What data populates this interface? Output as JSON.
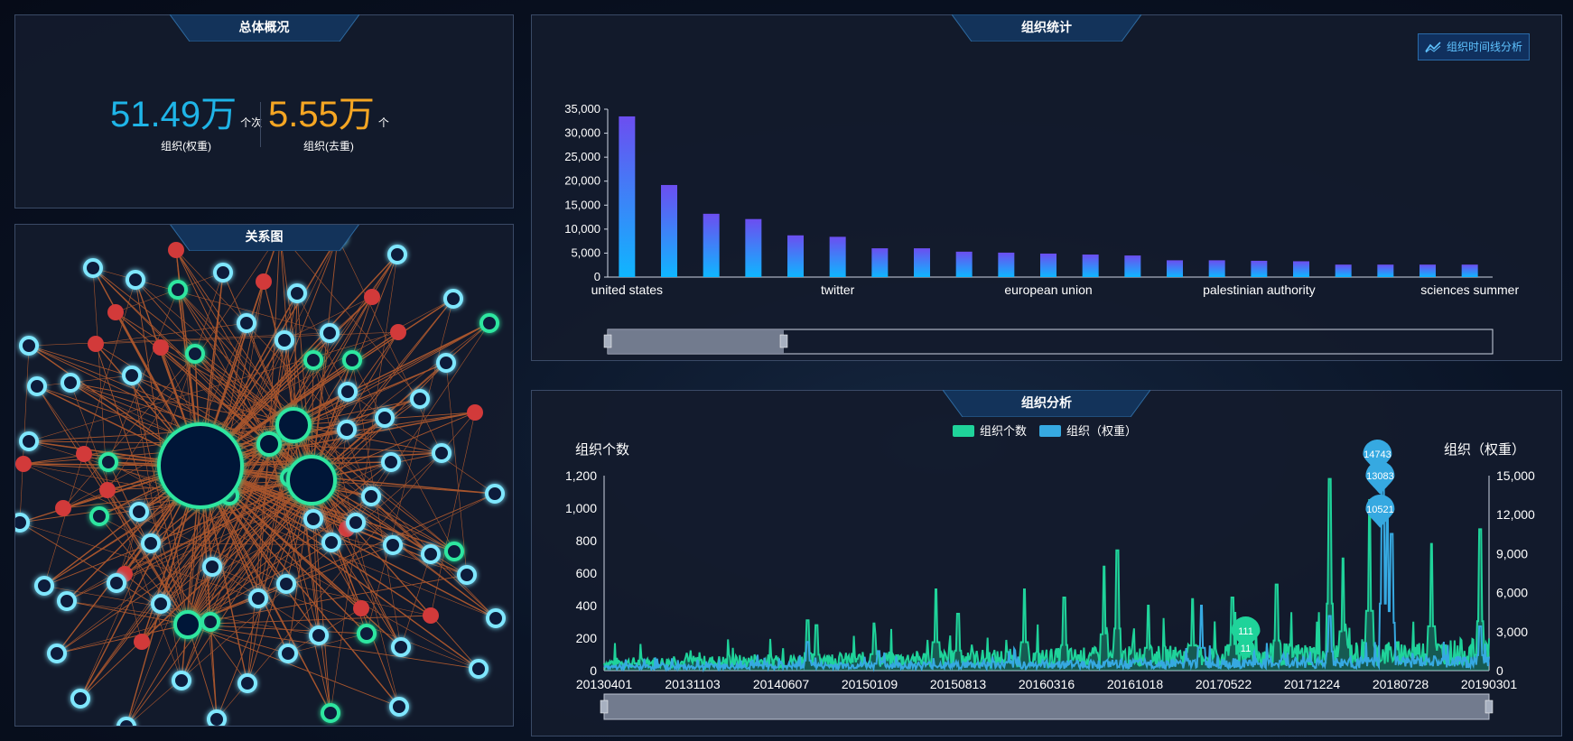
{
  "overview": {
    "title": "总体概况",
    "stat1_value": "51.49万",
    "stat1_unit": "个次",
    "stat1_label": "组织(权重)",
    "stat2_value": "5.55万",
    "stat2_unit": "个",
    "stat2_label": "组织(去重)",
    "colors": {
      "stat1": "#1fb5e8",
      "stat2": "#f5a623"
    }
  },
  "graph": {
    "title": "关系图",
    "colors": {
      "edge": "#d9692e",
      "node_cyan": "#7fe7ff",
      "node_green": "#2ee6a0",
      "node_red": "#d23a3a",
      "node_fill": "#0b1a3a"
    }
  },
  "org_stats": {
    "title": "组织统计",
    "timeline_button": "组织时间线分析",
    "timeline_icon": "line-chart-icon"
  },
  "analysis": {
    "title": "组织分析"
  },
  "chart_data": [
    {
      "type": "bar",
      "categories": [
        "united states",
        "",
        "",
        "",
        "",
        "twitter",
        "",
        "",
        "",
        "",
        "european union",
        "",
        "",
        "",
        "",
        "palestinian authority",
        "",
        "",
        "",
        "",
        "sciences summer"
      ],
      "visible_category_labels": [
        "united states",
        "twitter",
        "european union",
        "palestinian authority",
        "sciences summer"
      ],
      "values": [
        33500,
        19200,
        13200,
        12100,
        8700,
        8400,
        6000,
        6000,
        5300,
        5100,
        4900,
        4700,
        4500,
        3500,
        3500,
        3400,
        3300,
        2600,
        2600,
        2600,
        2600
      ],
      "yticks": [
        "0",
        "5,000",
        "10,000",
        "15,000",
        "20,000",
        "25,000",
        "30,000",
        "35,000"
      ],
      "ylim": [
        0,
        35000
      ],
      "colors": {
        "top": "#6c4ef0",
        "bottom": "#0fb6ff"
      },
      "datazoom": "bottom"
    },
    {
      "type": "line",
      "legend": [
        "组织个数",
        "组织（权重）"
      ],
      "ylabel_left": "组织个数",
      "ylabel_right": "组织（权重）",
      "yticks_left": [
        "0",
        "200",
        "400",
        "600",
        "800",
        "1,000",
        "1,200"
      ],
      "yticks_right": [
        "0",
        "3,000",
        "6,000",
        "9,000",
        "12,000",
        "15,000"
      ],
      "ylim_left": [
        0,
        1200
      ],
      "ylim_right": [
        0,
        15000
      ],
      "xticks": [
        "20130401",
        "20131103",
        "20140607",
        "20150109",
        "20150813",
        "20160316",
        "20161018",
        "20170522",
        "20171224",
        "20180728",
        "20190301"
      ],
      "series": [
        {
          "name": "组织个数",
          "color": "#1fd39a",
          "spikes": [
            [
              0.23,
              310
            ],
            [
              0.24,
              280
            ],
            [
              0.305,
              290
            ],
            [
              0.375,
              500
            ],
            [
              0.4,
              350
            ],
            [
              0.475,
              500
            ],
            [
              0.52,
              450
            ],
            [
              0.565,
              640
            ],
            [
              0.58,
              740
            ],
            [
              0.615,
              400
            ],
            [
              0.665,
              440
            ],
            [
              0.71,
              450
            ],
            [
              0.76,
              530
            ],
            [
              0.82,
              1180
            ],
            [
              0.835,
              690
            ],
            [
              0.865,
              1050
            ],
            [
              0.935,
              780
            ],
            [
              0.99,
              870
            ]
          ]
        },
        {
          "name": "组织（权重）",
          "color": "#36a9e1",
          "spikes": [
            [
              0.23,
              2200
            ],
            [
              0.31,
              1500
            ],
            [
              0.675,
              5000
            ],
            [
              0.82,
              4200
            ],
            [
              0.88,
              14743
            ],
            [
              0.885,
              13083
            ],
            [
              0.89,
              10521
            ],
            [
              0.99,
              3400
            ]
          ]
        }
      ],
      "markers": [
        {
          "label": "14743",
          "series": 1,
          "value": 14743
        },
        {
          "label": "13083",
          "series": 1,
          "value": 13083
        },
        {
          "label": "10521",
          "series": 1,
          "value": 10521
        },
        {
          "label": "111",
          "series": 0,
          "value": 111
        },
        {
          "label": "11",
          "series": 0,
          "value": 11
        }
      ],
      "datazoom": "bottom"
    }
  ]
}
